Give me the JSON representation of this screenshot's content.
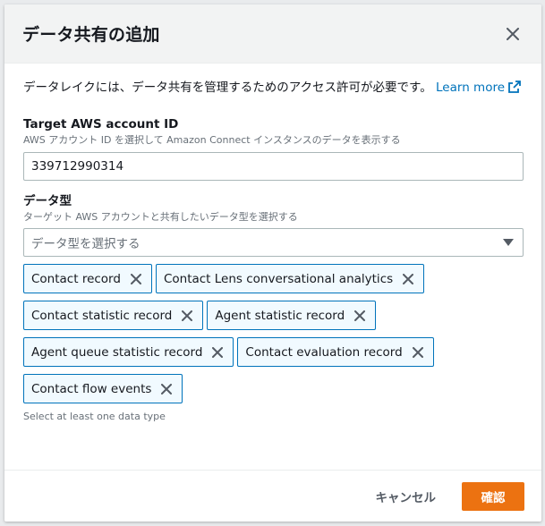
{
  "modal": {
    "title": "データ共有の追加",
    "info_text": "データレイクには、データ共有を管理するためのアクセス許可が必要です。",
    "learn_more": "Learn more"
  },
  "account_field": {
    "label": "Target AWS account ID",
    "description": "AWS アカウント ID を選択して Amazon Connect インスタンスのデータを表示する",
    "value": "339712990314"
  },
  "data_type_field": {
    "label": "データ型",
    "description": "ターゲット AWS アカウントと共有したいデータ型を選択する",
    "placeholder": "データ型を選択する",
    "tokens": [
      "Contact record",
      "Contact Lens conversational analytics",
      "Contact statistic record",
      "Agent statistic record",
      "Agent queue statistic record",
      "Contact evaluation record",
      "Contact flow events"
    ],
    "constraint": "Select at least one data type"
  },
  "footer": {
    "cancel_label": "キャンセル",
    "confirm_label": "確認"
  },
  "icons": {
    "close": "close-icon",
    "external": "external-link-icon",
    "caret": "caret-down-icon",
    "token_remove": "x-icon"
  },
  "colors": {
    "link": "#0073bb",
    "primary": "#ec7211",
    "token_border": "#0073bb",
    "token_bg": "#f1faff"
  }
}
